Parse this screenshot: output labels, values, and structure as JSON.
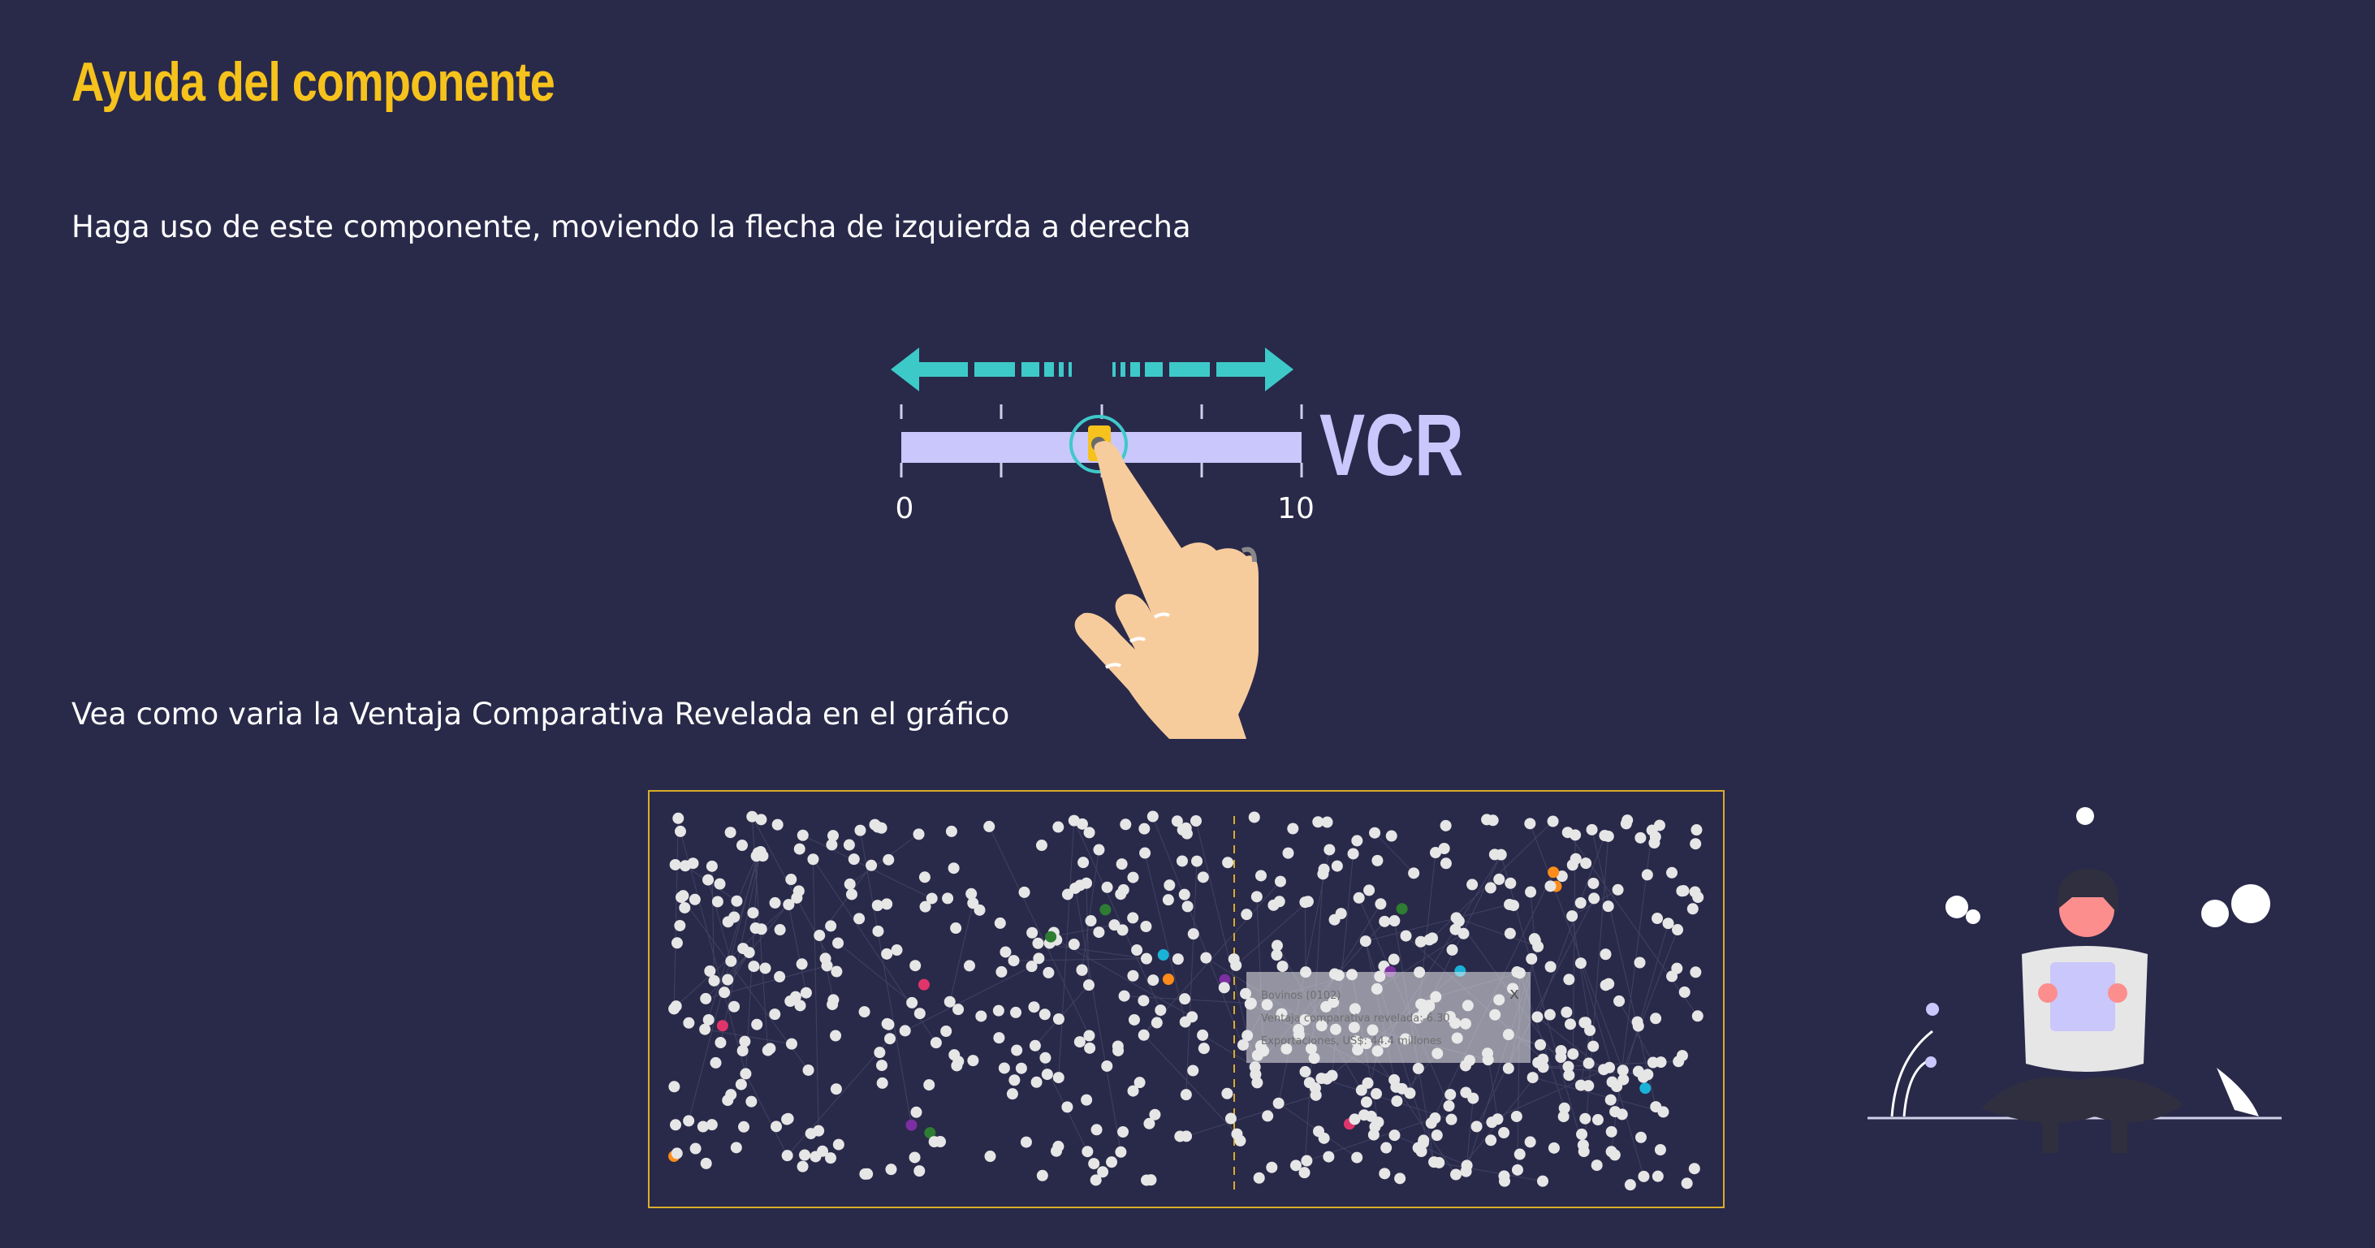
{
  "page": {
    "title": "Ayuda del componente",
    "instruction": "Haga uso de este componente, moviendo la flecha de izquierda a derecha",
    "description": "Vea como varia la Ventaja Comparativa Revelada en el gráfico"
  },
  "slider": {
    "label": "VCR",
    "min_label": "0",
    "max_label": "10",
    "value": 5,
    "min": 0,
    "max": 10
  },
  "graph": {
    "tooltip": {
      "line1": "Bovinos (0102)",
      "line2": "Ventaja comparativa revelada: 6.30",
      "line3": "Exportaciones, US$: 44.4 millones",
      "close": "x"
    }
  },
  "colors": {
    "background": "#29294a",
    "accent_yellow": "#f6c21c",
    "arrow_teal": "#3ec9c9",
    "track_lavender": "#c9c7fb",
    "node_white": "#e6e6e6"
  },
  "icons": {
    "arrows": "double-arrow-icon",
    "hand": "pointing-hand-icon",
    "close": "close-icon"
  }
}
